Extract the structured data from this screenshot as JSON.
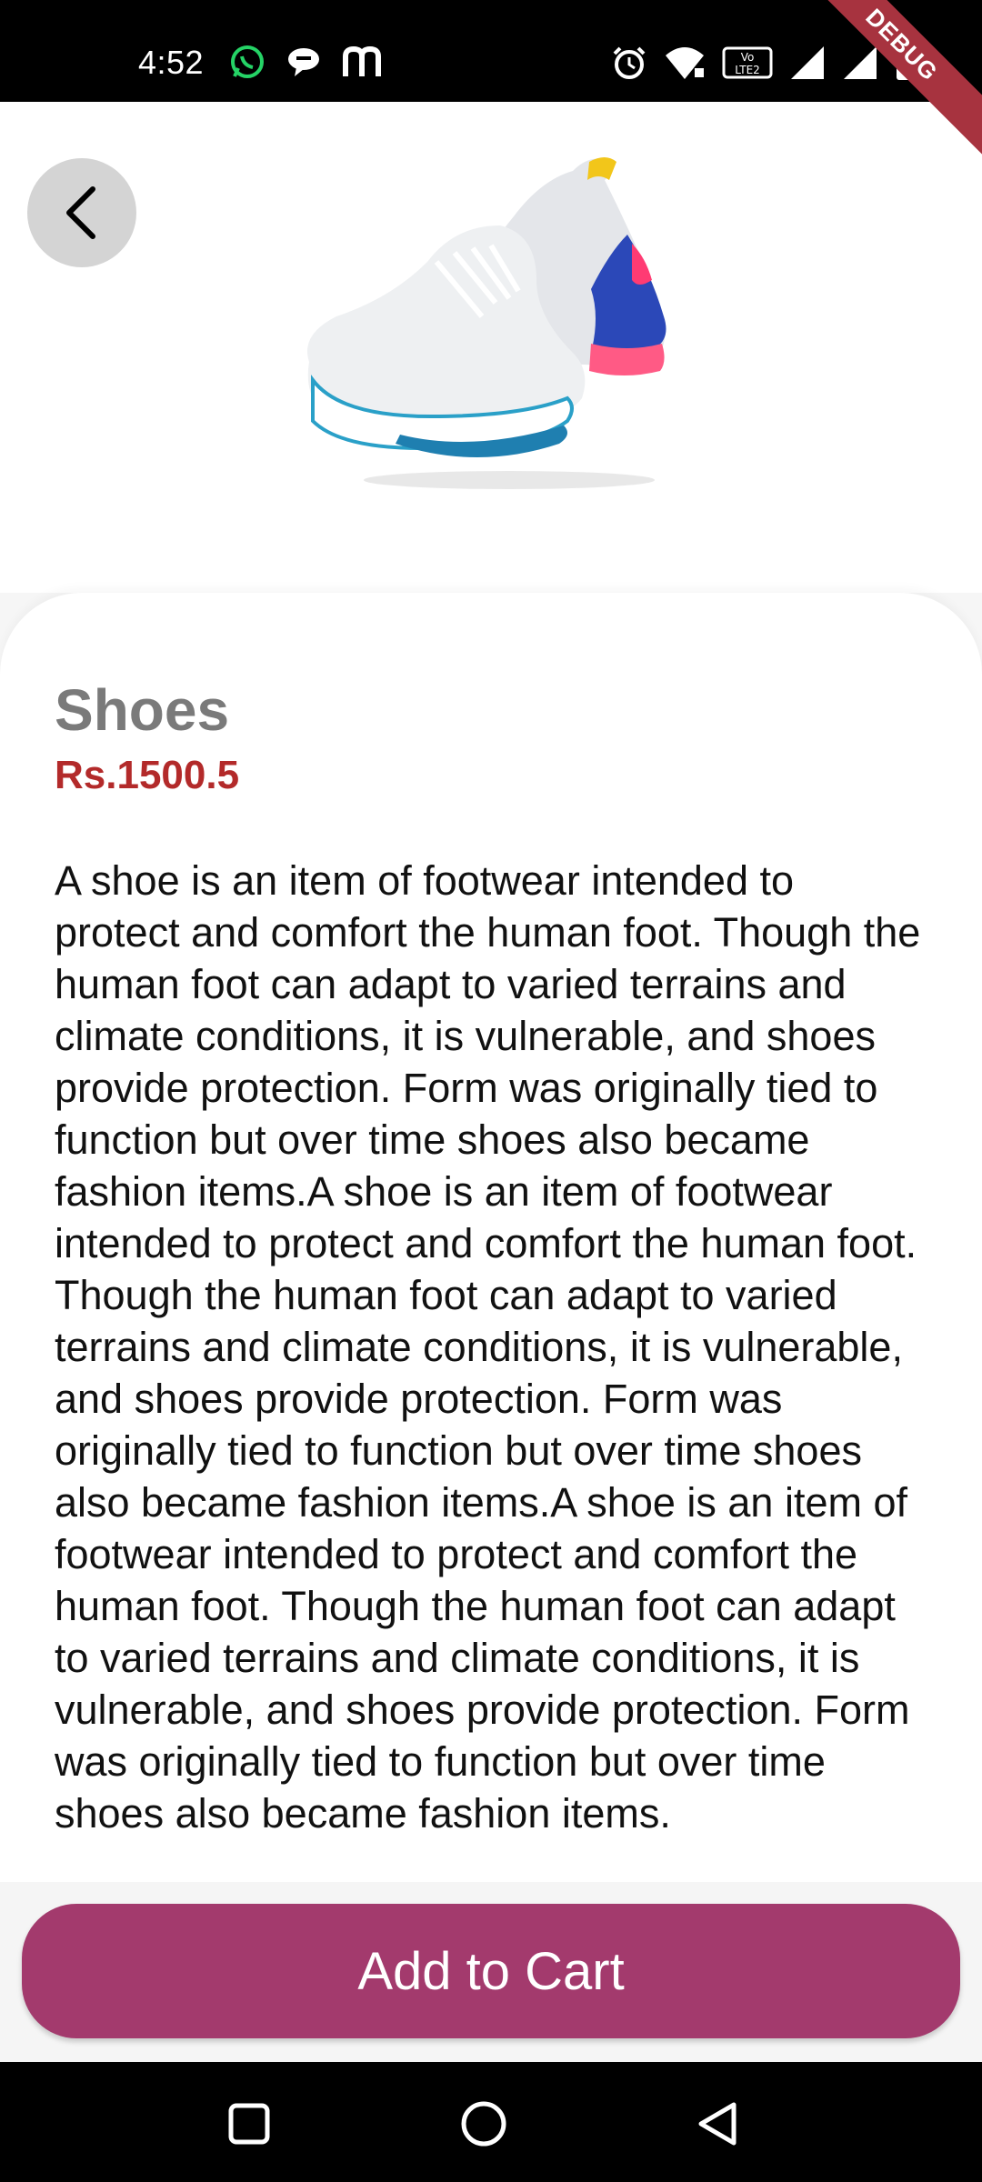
{
  "status_bar": {
    "time": "4:52",
    "left_icons": [
      "whatsapp-icon",
      "message-bubble-icon",
      "m-app-icon"
    ],
    "right_icons": [
      "alarm-icon",
      "wifi-icon",
      "volte-lte2-icon",
      "signal-1-icon",
      "signal-2-icon",
      "battery-charging-icon"
    ],
    "lte_label": "Vo LTE 2"
  },
  "debug_banner": "DEBUG",
  "header": {
    "back_icon": "chevron-left-icon",
    "product_image": "sneaker-image"
  },
  "product": {
    "title": "Shoes",
    "price": "Rs.1500.5",
    "description": "A shoe is an item of footwear intended to protect and comfort the human foot. Though the human foot can adapt to varied terrains and climate conditions, it is vulnerable, and shoes provide protection. Form was originally tied to function but over time shoes also became fashion items.A shoe is an item of footwear intended to protect and comfort the human foot. Though the human foot can adapt to varied terrains and climate conditions, it is vulnerable, and shoes provide protection. Form was originally tied to function but over time shoes also became fashion items.A shoe is an item of footwear intended to protect and comfort the human foot. Though the human foot can adapt to varied terrains and climate conditions, it is vulnerable, and shoes provide protection. Form was originally tied to function but over time shoes also became fashion items."
  },
  "actions": {
    "add_to_cart_label": "Add to Cart"
  },
  "nav_bar": {
    "recents_icon": "square-recents-icon",
    "home_icon": "circle-home-icon",
    "back_icon": "triangle-back-icon"
  },
  "colors": {
    "accent_button": "#a33a6d",
    "price": "#b32a2a",
    "title": "#7a7a7a",
    "debug": "#a7333f"
  }
}
